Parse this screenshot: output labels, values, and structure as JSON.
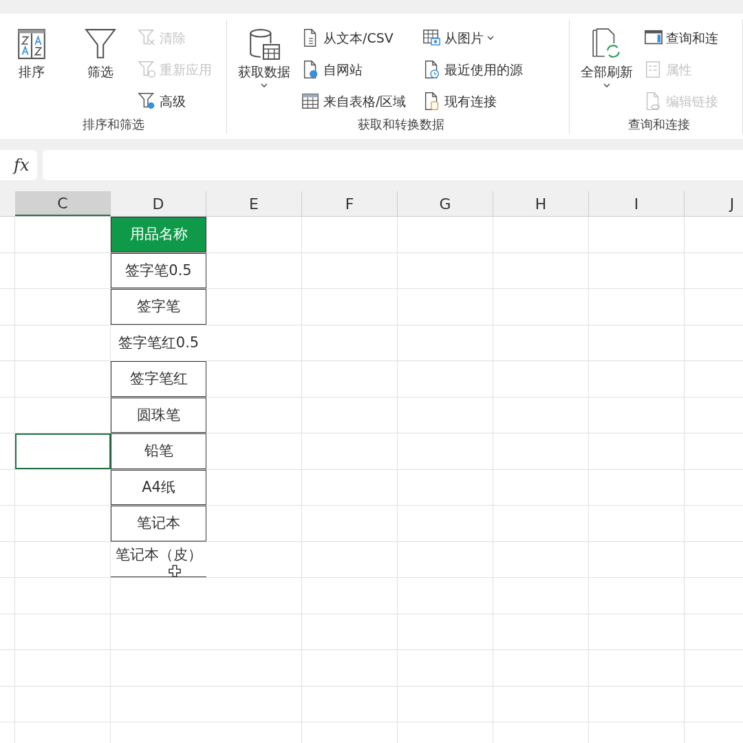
{
  "ribbon": {
    "groups": [
      {
        "label": "排序和筛选",
        "large": [
          {
            "label": "排序",
            "dropdown": false
          },
          {
            "label": "筛选",
            "dropdown": false
          }
        ],
        "columns": [
          [
            {
              "label": "清除",
              "disabled": true,
              "dropdown": false
            },
            {
              "label": "重新应用",
              "disabled": true,
              "dropdown": false
            },
            {
              "label": "高级",
              "disabled": false,
              "dropdown": false
            }
          ]
        ]
      },
      {
        "label": "获取和转换数据",
        "large": [
          {
            "label": "获取数据",
            "dropdown": true
          }
        ],
        "columns": [
          [
            {
              "label": "从文本/CSV",
              "disabled": false,
              "dropdown": false
            },
            {
              "label": "自网站",
              "disabled": false,
              "dropdown": false
            },
            {
              "label": "来自表格/区域",
              "disabled": false,
              "dropdown": false
            }
          ],
          [
            {
              "label": "从图片",
              "disabled": false,
              "dropdown": true
            },
            {
              "label": "最近使用的源",
              "disabled": false,
              "dropdown": false
            },
            {
              "label": "现有连接",
              "disabled": false,
              "dropdown": false
            }
          ]
        ]
      },
      {
        "label": "查询和连接",
        "large": [
          {
            "label": "全部刷新",
            "dropdown": true
          }
        ],
        "columns": [
          [
            {
              "label": "查询和连",
              "disabled": false,
              "dropdown": false
            },
            {
              "label": "属性",
              "disabled": true,
              "dropdown": false
            },
            {
              "label": "编辑链接",
              "disabled": true,
              "dropdown": false
            }
          ]
        ]
      }
    ]
  },
  "formula_bar": {
    "fx": "fx"
  },
  "sheet": {
    "columns": [
      {
        "label": "C",
        "selected": true
      },
      {
        "label": "D",
        "selected": false
      },
      {
        "label": "E",
        "selected": false
      },
      {
        "label": "F",
        "selected": false
      },
      {
        "label": "G",
        "selected": false
      },
      {
        "label": "H",
        "selected": false
      },
      {
        "label": "I",
        "selected": false
      },
      {
        "label": "J",
        "selected": false
      }
    ],
    "rows": [
      {
        "c_selected": false,
        "d": {
          "text": "用品名称",
          "kind": "header"
        }
      },
      {
        "c_selected": false,
        "d": {
          "text": "签字笔0.5",
          "kind": "boxed"
        }
      },
      {
        "c_selected": false,
        "d": {
          "text": "签字笔",
          "kind": "boxed"
        }
      },
      {
        "c_selected": false,
        "d": {
          "text": "签字笔红0.5",
          "kind": "plain"
        }
      },
      {
        "c_selected": false,
        "d": {
          "text": "签字笔红",
          "kind": "boxed"
        }
      },
      {
        "c_selected": false,
        "d": {
          "text": "圆珠笔",
          "kind": "boxed"
        }
      },
      {
        "c_selected": true,
        "d": {
          "text": "铅笔",
          "kind": "boxed"
        }
      },
      {
        "c_selected": false,
        "d": {
          "text": "A4纸",
          "kind": "boxed"
        }
      },
      {
        "c_selected": false,
        "d": {
          "text": "笔记本",
          "kind": "boxed"
        }
      },
      {
        "c_selected": false,
        "d": {
          "text": "笔记本（皮）",
          "kind": "underlined"
        }
      },
      {
        "c_selected": false,
        "d": {
          "kind": "empty"
        }
      },
      {
        "c_selected": false,
        "d": {
          "kind": "empty"
        }
      },
      {
        "c_selected": false,
        "d": {
          "kind": "empty"
        }
      },
      {
        "c_selected": false,
        "d": {
          "kind": "empty"
        }
      },
      {
        "c_selected": false,
        "d": {
          "kind": "empty"
        }
      }
    ]
  }
}
